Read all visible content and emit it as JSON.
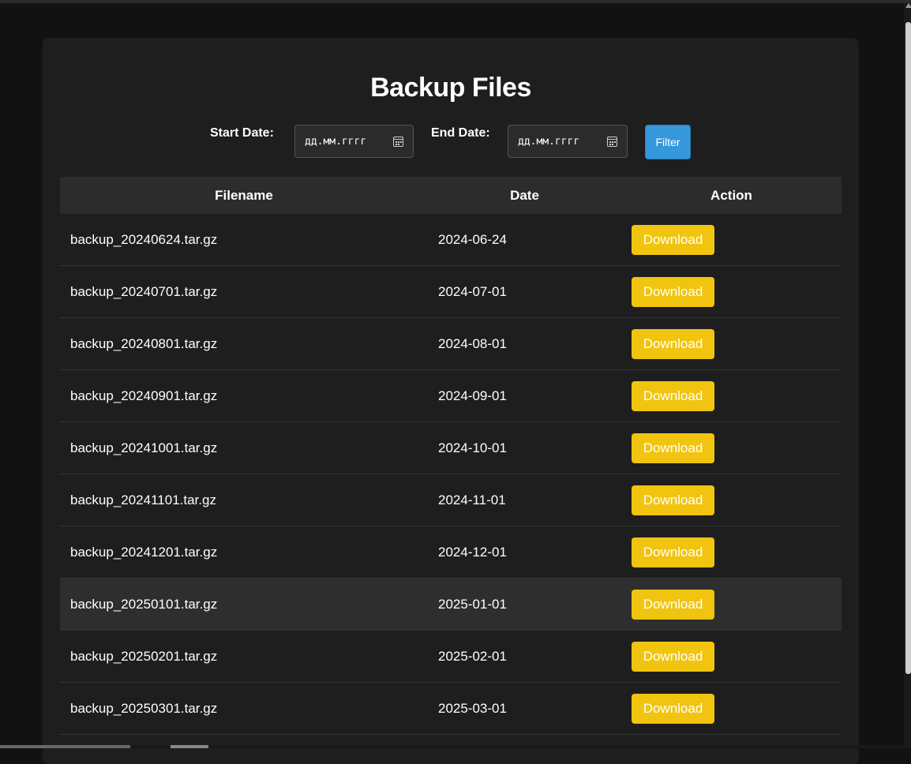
{
  "page": {
    "title": "Backup Files"
  },
  "filter": {
    "start_label": "Start Date:",
    "end_label": "End Date:",
    "start_placeholder": "дд.мм.гггг",
    "end_placeholder": "дд.мм.гггг",
    "button_label": "Filter"
  },
  "table": {
    "headers": [
      "Filename",
      "Date",
      "Action"
    ],
    "rows": [
      {
        "filename": "backup_20240624.tar.gz",
        "date": "2024-06-24",
        "action": "Download"
      },
      {
        "filename": "backup_20240701.tar.gz",
        "date": "2024-07-01",
        "action": "Download"
      },
      {
        "filename": "backup_20240801.tar.gz",
        "date": "2024-08-01",
        "action": "Download"
      },
      {
        "filename": "backup_20240901.tar.gz",
        "date": "2024-09-01",
        "action": "Download"
      },
      {
        "filename": "backup_20241001.tar.gz",
        "date": "2024-10-01",
        "action": "Download"
      },
      {
        "filename": "backup_20241101.tar.gz",
        "date": "2024-11-01",
        "action": "Download"
      },
      {
        "filename": "backup_20241201.tar.gz",
        "date": "2024-12-01",
        "action": "Download"
      },
      {
        "filename": "backup_20250101.tar.gz",
        "date": "2025-01-01",
        "action": "Download"
      },
      {
        "filename": "backup_20250201.tar.gz",
        "date": "2025-02-01",
        "action": "Download"
      },
      {
        "filename": "backup_20250301.tar.gz",
        "date": "2025-03-01",
        "action": "Download"
      }
    ]
  },
  "colors": {
    "background": "#121212",
    "card": "#1e1e1e",
    "header_row": "#2c2c2c",
    "filter_button": "#3498db",
    "download_button": "#f1c40f",
    "hover_row": "#2e2e2e"
  },
  "icons": {
    "date_picker": "calendar-icon"
  }
}
